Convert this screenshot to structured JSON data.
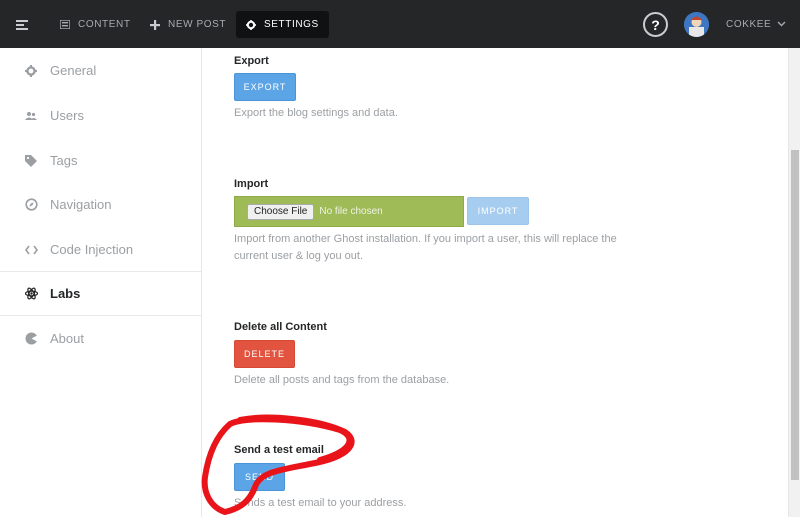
{
  "topbar": {
    "content_label": "CONTENT",
    "new_post_label": "NEW POST",
    "settings_label": "SETTINGS",
    "help_label": "?",
    "user_label": "COKKEE",
    "icons": [
      "menu-icon",
      "content-icon",
      "plus-icon",
      "gear-icon",
      "question-icon",
      "avatar",
      "chevron-down-icon"
    ]
  },
  "sidebar": {
    "items": [
      {
        "label": "General",
        "icon": "gear-icon"
      },
      {
        "label": "Users",
        "icon": "users-icon"
      },
      {
        "label": "Tags",
        "icon": "tag-icon"
      },
      {
        "label": "Navigation",
        "icon": "compass-icon"
      },
      {
        "label": "Code Injection",
        "icon": "code-icon"
      },
      {
        "label": "Labs",
        "icon": "atom-icon",
        "active": true
      },
      {
        "label": "About",
        "icon": "ghost-icon"
      }
    ]
  },
  "main": {
    "export": {
      "title": "Export",
      "button": "EXPORT",
      "description": "Export the blog settings and data."
    },
    "import": {
      "title": "Import",
      "choose_file": "Choose File",
      "no_file": "No file chosen",
      "button": "IMPORT",
      "description": "Import from another Ghost installation. If you import a user, this will replace the current user & log you out."
    },
    "delete": {
      "title": "Delete all Content",
      "button": "DELETE",
      "description": "Delete all posts and tags from the database."
    },
    "test_email": {
      "title": "Send a test email",
      "button": "SEND",
      "description": "Sends a test email to your address."
    }
  },
  "colors": {
    "topbar_bg": "#242628",
    "blue_button": "#5ba4e5",
    "red_button": "#e25440",
    "file_input_bg": "#9fbb58",
    "annotation": "#e8141a"
  }
}
